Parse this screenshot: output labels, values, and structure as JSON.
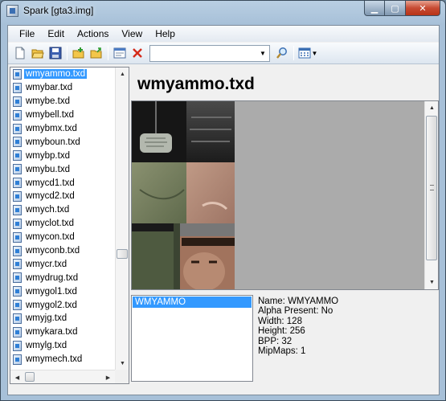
{
  "window": {
    "title": "Spark [gta3.img]"
  },
  "menu": [
    "File",
    "Edit",
    "Actions",
    "View",
    "Help"
  ],
  "toolbar": {
    "buttons": [
      "new-icon",
      "open-icon",
      "save-icon",
      "folder-add-icon",
      "folder-export-icon",
      "properties-icon",
      "delete-icon"
    ],
    "search_value": "",
    "search_icon": "magnifier-icon",
    "view_icon": "grid-view-icon"
  },
  "files": [
    "wmyammo.txd",
    "wmybar.txd",
    "wmybe.txd",
    "wmybell.txd",
    "wmybmx.txd",
    "wmyboun.txd",
    "wmybp.txd",
    "wmybu.txd",
    "wmycd1.txd",
    "wmycd2.txd",
    "wmych.txd",
    "wmyclot.txd",
    "wmycon.txd",
    "wmyconb.txd",
    "wmycr.txd",
    "wmydrug.txd",
    "wmygol1.txd",
    "wmygol2.txd",
    "wmyjg.txd",
    "wmykara.txd",
    "wmylg.txd",
    "wmymech.txd"
  ],
  "selected_file": "wmyammo.txd",
  "texture_header": "wmyammo.txd",
  "textures": [
    "WMYAMMO"
  ],
  "texture_info": {
    "name": "Name: WMYAMMO",
    "alpha": "Alpha Present: No",
    "width": "Width: 128",
    "height": "Height: 256",
    "bpp": "BPP: 32",
    "mipmaps": "MipMaps: 1"
  },
  "colors": {
    "selection": "#3399ff",
    "preview_bg": "#ababab"
  }
}
